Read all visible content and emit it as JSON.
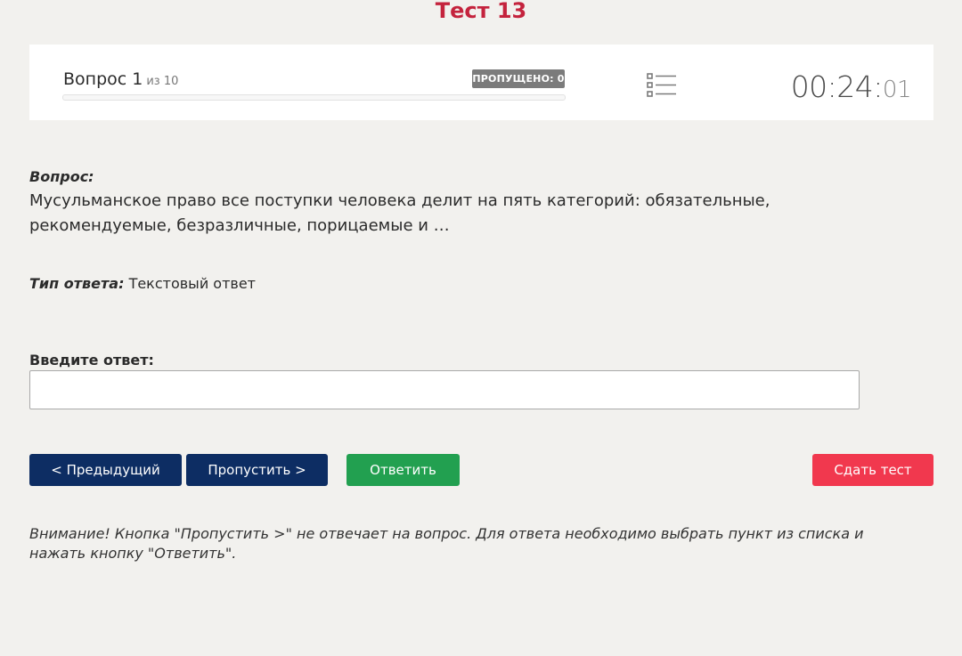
{
  "page": {
    "title": "Тест 13"
  },
  "header": {
    "question_label": "Вопрос 1",
    "question_of": "из 10",
    "skipped_badge": "ПРОПУЩЕНО: 0",
    "progress_fraction": 0,
    "list_icon": "question-list-icon",
    "timer_main": "00:24:",
    "timer_seconds": "01"
  },
  "question": {
    "label": "Вопрос:",
    "text": "Мусульманское право все поступки человека делит на пять категорий: обязательные, рекомендуемые, безразличные, порицаемые и …"
  },
  "answer_type": {
    "label": "Тип ответа:",
    "value": "Текстовый ответ"
  },
  "answer": {
    "label": "Введите ответ:",
    "value": "",
    "placeholder": ""
  },
  "buttons": {
    "prev": "< Предыдущий",
    "skip": "Пропустить >",
    "answer": "Ответить",
    "submit": "Сдать тест"
  },
  "colors": {
    "title": "#c4233d",
    "nav_button": "#0d2d63",
    "answer_button": "#22a050",
    "submit_button": "#f1384e"
  },
  "notice": "Внимание! Кнопка \"Пропустить >\" не отвечает на вопрос. Для ответа необходимо выбрать пункт из списка и нажать кнопку \"Ответить\"."
}
